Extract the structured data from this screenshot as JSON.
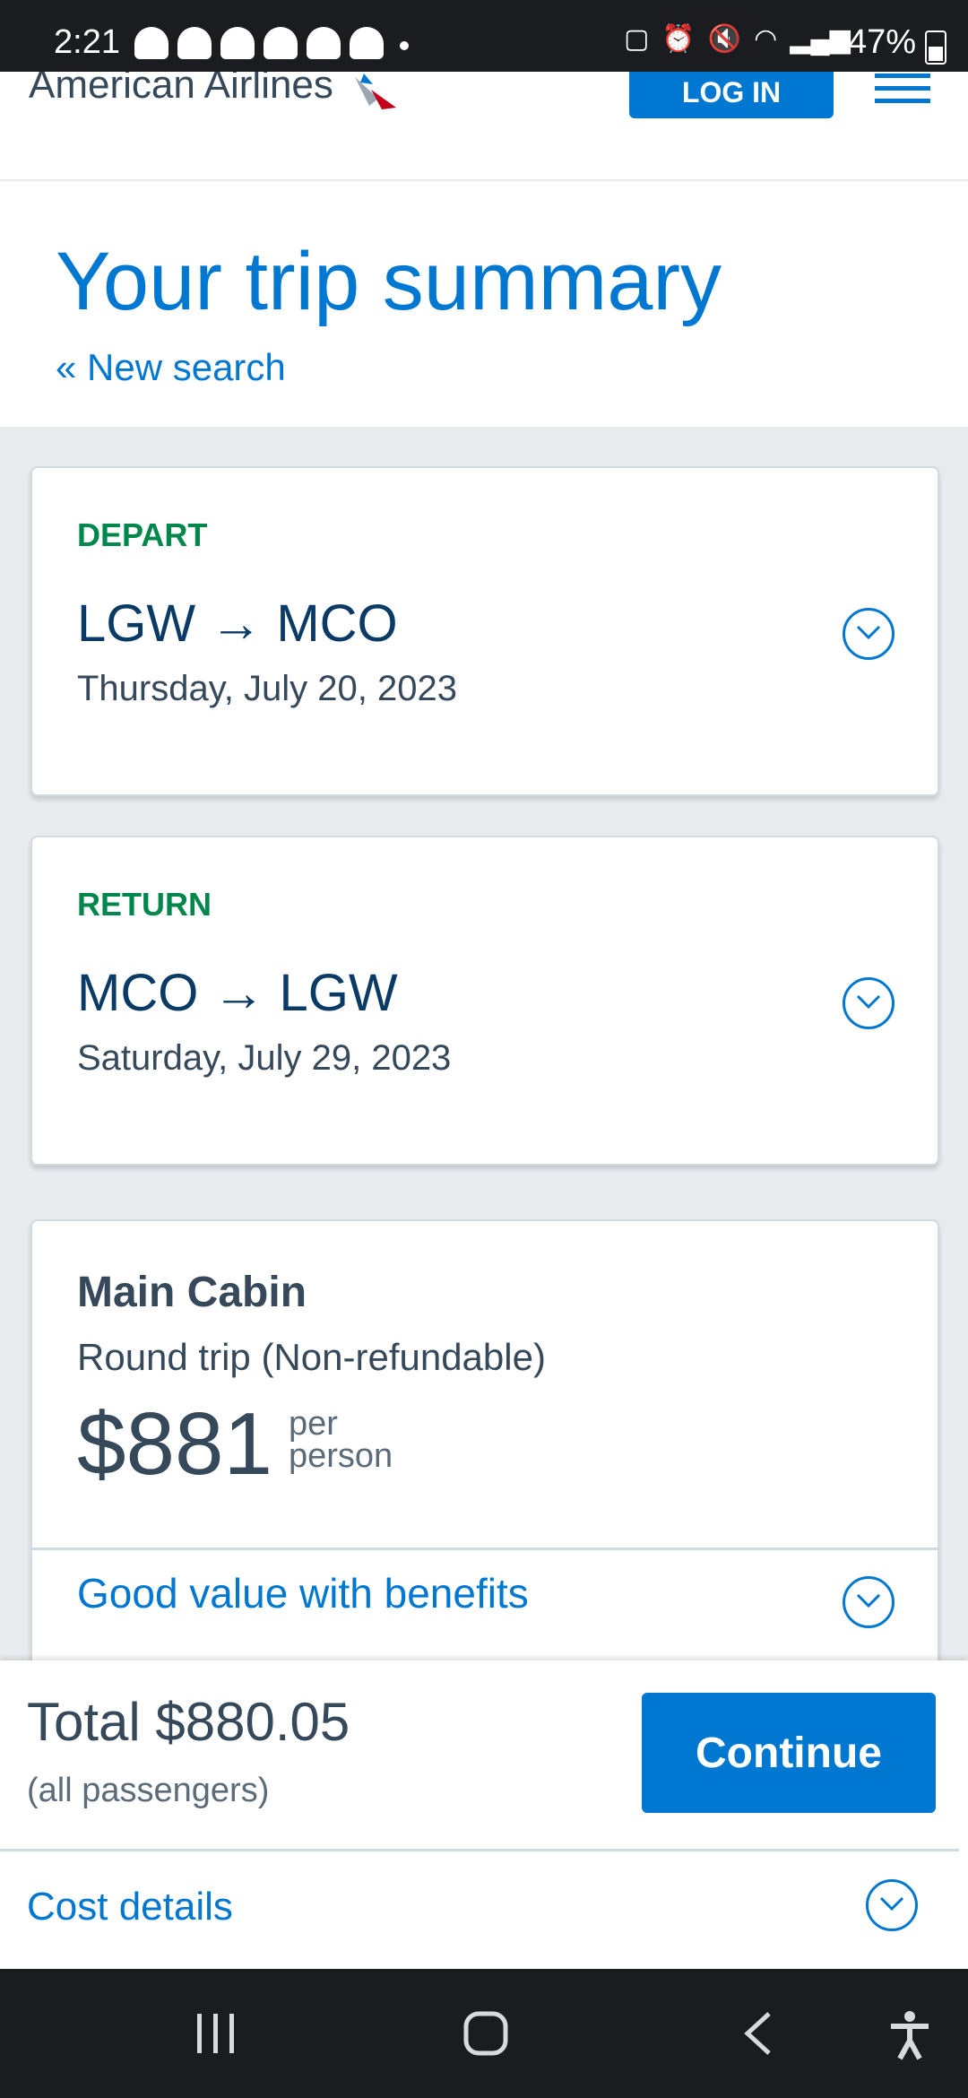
{
  "status_bar": {
    "time": "2:21",
    "battery": "47%"
  },
  "header": {
    "logo": "American Airlines",
    "login_label": "LOG IN"
  },
  "summary": {
    "title": "Your trip summary",
    "new_search": "« New search"
  },
  "depart": {
    "label": "DEPART",
    "route": "LGW → MCO",
    "date": "Thursday, July 20, 2023"
  },
  "return": {
    "label": "RETURN",
    "route": "MCO → LGW",
    "date": "Saturday, July 29, 2023"
  },
  "fare": {
    "cabin": "Main Cabin",
    "trip_type": "Round trip (Non-refundable)",
    "price": "$881",
    "per": "per",
    "person": "person",
    "benefits": "Good value with benefits"
  },
  "footer": {
    "total": "Total $880.05",
    "passengers": "(all passengers)",
    "continue_label": "Continue",
    "cost_details": "Cost details"
  },
  "colors": {
    "accent": "#0078d2",
    "green": "#00874b",
    "text": "#36495a",
    "navy": "#0a3a66"
  }
}
